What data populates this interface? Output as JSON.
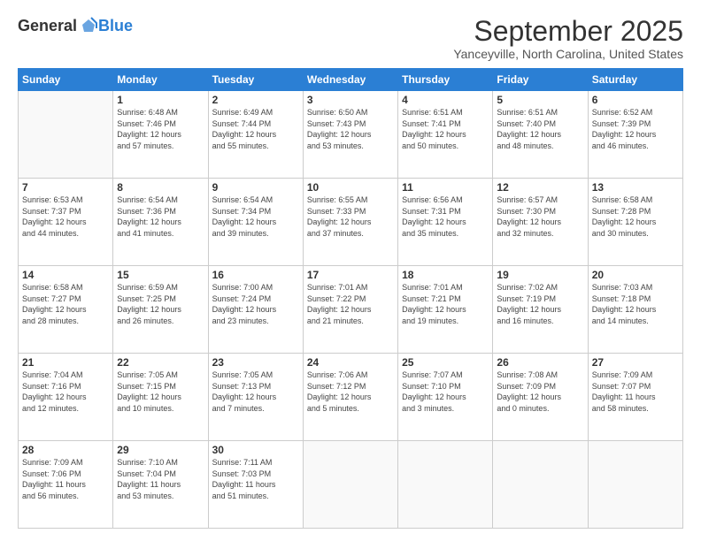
{
  "logo": {
    "general": "General",
    "blue": "Blue"
  },
  "header": {
    "month": "September 2025",
    "location": "Yanceyville, North Carolina, United States"
  },
  "days_header": [
    "Sunday",
    "Monday",
    "Tuesday",
    "Wednesday",
    "Thursday",
    "Friday",
    "Saturday"
  ],
  "weeks": [
    [
      {
        "day": "",
        "info": ""
      },
      {
        "day": "1",
        "info": "Sunrise: 6:48 AM\nSunset: 7:46 PM\nDaylight: 12 hours\nand 57 minutes."
      },
      {
        "day": "2",
        "info": "Sunrise: 6:49 AM\nSunset: 7:44 PM\nDaylight: 12 hours\nand 55 minutes."
      },
      {
        "day": "3",
        "info": "Sunrise: 6:50 AM\nSunset: 7:43 PM\nDaylight: 12 hours\nand 53 minutes."
      },
      {
        "day": "4",
        "info": "Sunrise: 6:51 AM\nSunset: 7:41 PM\nDaylight: 12 hours\nand 50 minutes."
      },
      {
        "day": "5",
        "info": "Sunrise: 6:51 AM\nSunset: 7:40 PM\nDaylight: 12 hours\nand 48 minutes."
      },
      {
        "day": "6",
        "info": "Sunrise: 6:52 AM\nSunset: 7:39 PM\nDaylight: 12 hours\nand 46 minutes."
      }
    ],
    [
      {
        "day": "7",
        "info": "Sunrise: 6:53 AM\nSunset: 7:37 PM\nDaylight: 12 hours\nand 44 minutes."
      },
      {
        "day": "8",
        "info": "Sunrise: 6:54 AM\nSunset: 7:36 PM\nDaylight: 12 hours\nand 41 minutes."
      },
      {
        "day": "9",
        "info": "Sunrise: 6:54 AM\nSunset: 7:34 PM\nDaylight: 12 hours\nand 39 minutes."
      },
      {
        "day": "10",
        "info": "Sunrise: 6:55 AM\nSunset: 7:33 PM\nDaylight: 12 hours\nand 37 minutes."
      },
      {
        "day": "11",
        "info": "Sunrise: 6:56 AM\nSunset: 7:31 PM\nDaylight: 12 hours\nand 35 minutes."
      },
      {
        "day": "12",
        "info": "Sunrise: 6:57 AM\nSunset: 7:30 PM\nDaylight: 12 hours\nand 32 minutes."
      },
      {
        "day": "13",
        "info": "Sunrise: 6:58 AM\nSunset: 7:28 PM\nDaylight: 12 hours\nand 30 minutes."
      }
    ],
    [
      {
        "day": "14",
        "info": "Sunrise: 6:58 AM\nSunset: 7:27 PM\nDaylight: 12 hours\nand 28 minutes."
      },
      {
        "day": "15",
        "info": "Sunrise: 6:59 AM\nSunset: 7:25 PM\nDaylight: 12 hours\nand 26 minutes."
      },
      {
        "day": "16",
        "info": "Sunrise: 7:00 AM\nSunset: 7:24 PM\nDaylight: 12 hours\nand 23 minutes."
      },
      {
        "day": "17",
        "info": "Sunrise: 7:01 AM\nSunset: 7:22 PM\nDaylight: 12 hours\nand 21 minutes."
      },
      {
        "day": "18",
        "info": "Sunrise: 7:01 AM\nSunset: 7:21 PM\nDaylight: 12 hours\nand 19 minutes."
      },
      {
        "day": "19",
        "info": "Sunrise: 7:02 AM\nSunset: 7:19 PM\nDaylight: 12 hours\nand 16 minutes."
      },
      {
        "day": "20",
        "info": "Sunrise: 7:03 AM\nSunset: 7:18 PM\nDaylight: 12 hours\nand 14 minutes."
      }
    ],
    [
      {
        "day": "21",
        "info": "Sunrise: 7:04 AM\nSunset: 7:16 PM\nDaylight: 12 hours\nand 12 minutes."
      },
      {
        "day": "22",
        "info": "Sunrise: 7:05 AM\nSunset: 7:15 PM\nDaylight: 12 hours\nand 10 minutes."
      },
      {
        "day": "23",
        "info": "Sunrise: 7:05 AM\nSunset: 7:13 PM\nDaylight: 12 hours\nand 7 minutes."
      },
      {
        "day": "24",
        "info": "Sunrise: 7:06 AM\nSunset: 7:12 PM\nDaylight: 12 hours\nand 5 minutes."
      },
      {
        "day": "25",
        "info": "Sunrise: 7:07 AM\nSunset: 7:10 PM\nDaylight: 12 hours\nand 3 minutes."
      },
      {
        "day": "26",
        "info": "Sunrise: 7:08 AM\nSunset: 7:09 PM\nDaylight: 12 hours\nand 0 minutes."
      },
      {
        "day": "27",
        "info": "Sunrise: 7:09 AM\nSunset: 7:07 PM\nDaylight: 11 hours\nand 58 minutes."
      }
    ],
    [
      {
        "day": "28",
        "info": "Sunrise: 7:09 AM\nSunset: 7:06 PM\nDaylight: 11 hours\nand 56 minutes."
      },
      {
        "day": "29",
        "info": "Sunrise: 7:10 AM\nSunset: 7:04 PM\nDaylight: 11 hours\nand 53 minutes."
      },
      {
        "day": "30",
        "info": "Sunrise: 7:11 AM\nSunset: 7:03 PM\nDaylight: 11 hours\nand 51 minutes."
      },
      {
        "day": "",
        "info": ""
      },
      {
        "day": "",
        "info": ""
      },
      {
        "day": "",
        "info": ""
      },
      {
        "day": "",
        "info": ""
      }
    ]
  ]
}
